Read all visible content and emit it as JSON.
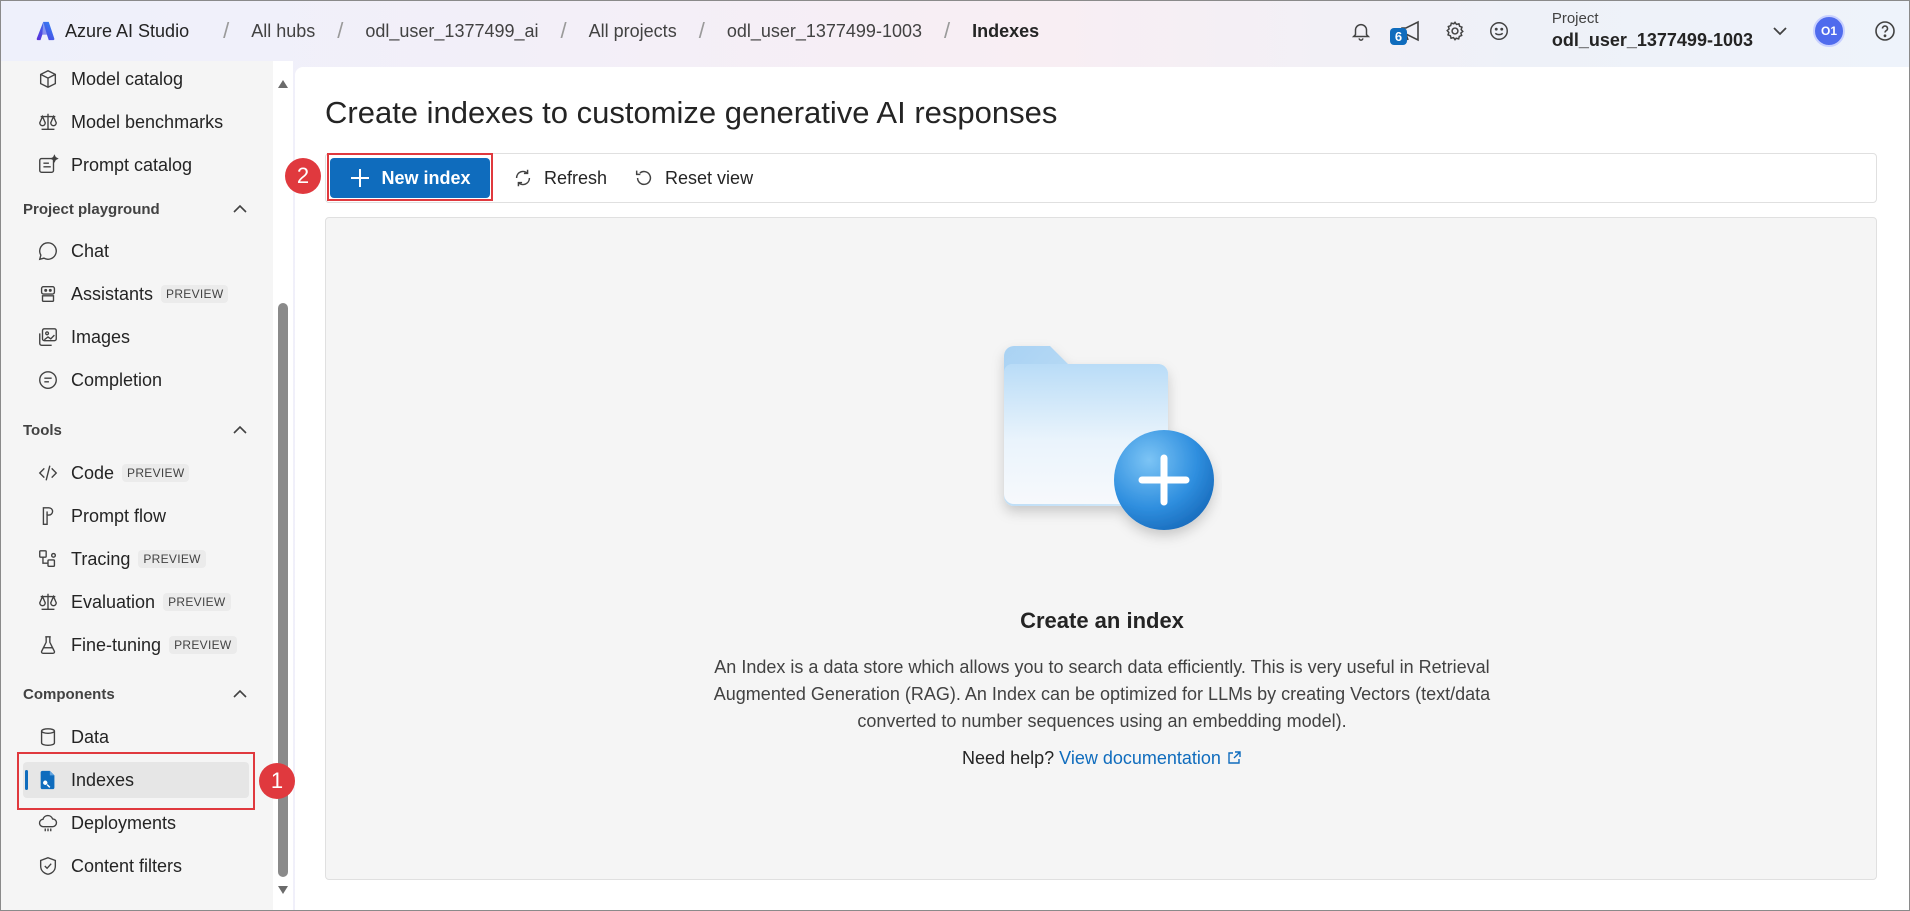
{
  "app": {
    "title": "Azure AI Studio"
  },
  "breadcrumbs": [
    "All hubs",
    "odl_user_1377499_ai",
    "All projects",
    "odl_user_1377499-1003",
    "Indexes"
  ],
  "topbar": {
    "notification_count": "6",
    "project_label": "Project",
    "project_name": "odl_user_1377499-1003",
    "avatar_initials": "O1"
  },
  "sidebar": {
    "top_items": [
      {
        "label": "Model catalog",
        "icon": "cube-icon"
      },
      {
        "label": "Model benchmarks",
        "icon": "scale-icon"
      },
      {
        "label": "Prompt catalog",
        "icon": "sparkle-list-icon"
      }
    ],
    "sections": [
      {
        "label": "Project playground",
        "items": [
          {
            "label": "Chat",
            "icon": "chat-icon"
          },
          {
            "label": "Assistants",
            "icon": "bot-icon",
            "tag": "PREVIEW"
          },
          {
            "label": "Images",
            "icon": "image-icon"
          },
          {
            "label": "Completion",
            "icon": "completion-icon"
          }
        ]
      },
      {
        "label": "Tools",
        "items": [
          {
            "label": "Code",
            "icon": "code-icon",
            "tag": "PREVIEW"
          },
          {
            "label": "Prompt flow",
            "icon": "flow-icon"
          },
          {
            "label": "Tracing",
            "icon": "tracing-icon",
            "tag": "PREVIEW"
          },
          {
            "label": "Evaluation",
            "icon": "scale-icon",
            "tag": "PREVIEW"
          },
          {
            "label": "Fine-tuning",
            "icon": "beaker-icon",
            "tag": "PREVIEW"
          }
        ]
      },
      {
        "label": "Components",
        "items": [
          {
            "label": "Data",
            "icon": "database-icon"
          },
          {
            "label": "Indexes",
            "icon": "index-icon",
            "selected": true
          },
          {
            "label": "Deployments",
            "icon": "cloud-icon"
          },
          {
            "label": "Content filters",
            "icon": "shield-icon"
          }
        ]
      }
    ]
  },
  "main": {
    "title": "Create indexes to customize generative AI responses",
    "toolbar": {
      "new_index": "New index",
      "refresh": "Refresh",
      "reset_view": "Reset view"
    },
    "empty_state": {
      "title": "Create an index",
      "description": "An Index is a data store which allows you to search data efficiently. This is very useful in Retrieval Augmented Generation (RAG). An Index can be optimized for LLMs by creating Vectors (text/data converted to number sequences using an embedding model).",
      "help_prefix": "Need help?",
      "help_link": "View documentation"
    }
  },
  "annotations": [
    "1",
    "2"
  ],
  "colors": {
    "accent": "#0f6cbd",
    "annotation": "#e0393e"
  }
}
